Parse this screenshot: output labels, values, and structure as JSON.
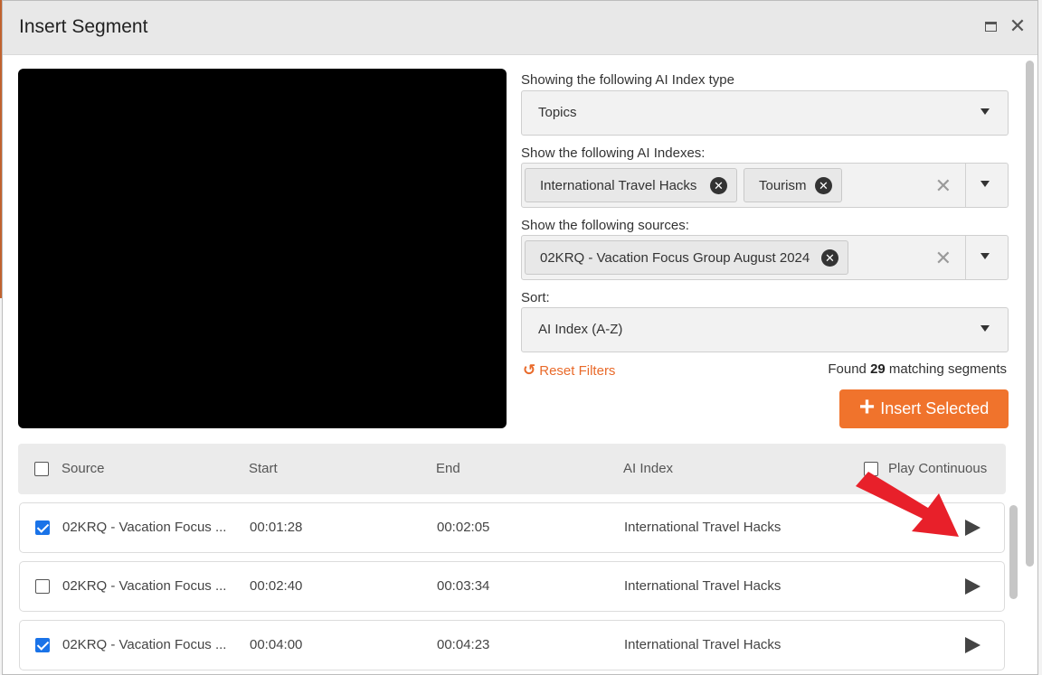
{
  "dialog": {
    "title": "Insert Segment"
  },
  "filters": {
    "index_type_label": "Showing the following AI Index type",
    "index_type_value": "Topics",
    "indexes_label": "Show the following AI Indexes:",
    "indexes": [
      "International Travel Hacks",
      "Tourism"
    ],
    "sources_label": "Show the following sources:",
    "sources": [
      "02KRQ - Vacation Focus Group August 2024"
    ],
    "sort_label": "Sort:",
    "sort_value": "AI Index (A-Z)",
    "reset_label": "Reset Filters"
  },
  "results": {
    "found_prefix": "Found",
    "count": "29",
    "found_suffix": "matching segments"
  },
  "insert_button": {
    "label": "Insert Selected"
  },
  "table": {
    "columns": {
      "source": "Source",
      "start": "Start",
      "end": "End",
      "ai_index": "AI Index",
      "play_continuous": "Play Continuous"
    },
    "rows": [
      {
        "checked": true,
        "source": "02KRQ - Vacation Focus ...",
        "start": "00:01:28",
        "end": "00:02:05",
        "ai_index": "International Travel Hacks"
      },
      {
        "checked": false,
        "source": "02KRQ - Vacation Focus ...",
        "start": "00:02:40",
        "end": "00:03:34",
        "ai_index": "International Travel Hacks"
      },
      {
        "checked": true,
        "source": "02KRQ - Vacation Focus ...",
        "start": "00:04:00",
        "end": "00:04:23",
        "ai_index": "International Travel Hacks"
      }
    ]
  },
  "colors": {
    "accent": "#f0732c",
    "checkbox": "#1a73e8",
    "annotation_arrow": "#e8202a"
  }
}
